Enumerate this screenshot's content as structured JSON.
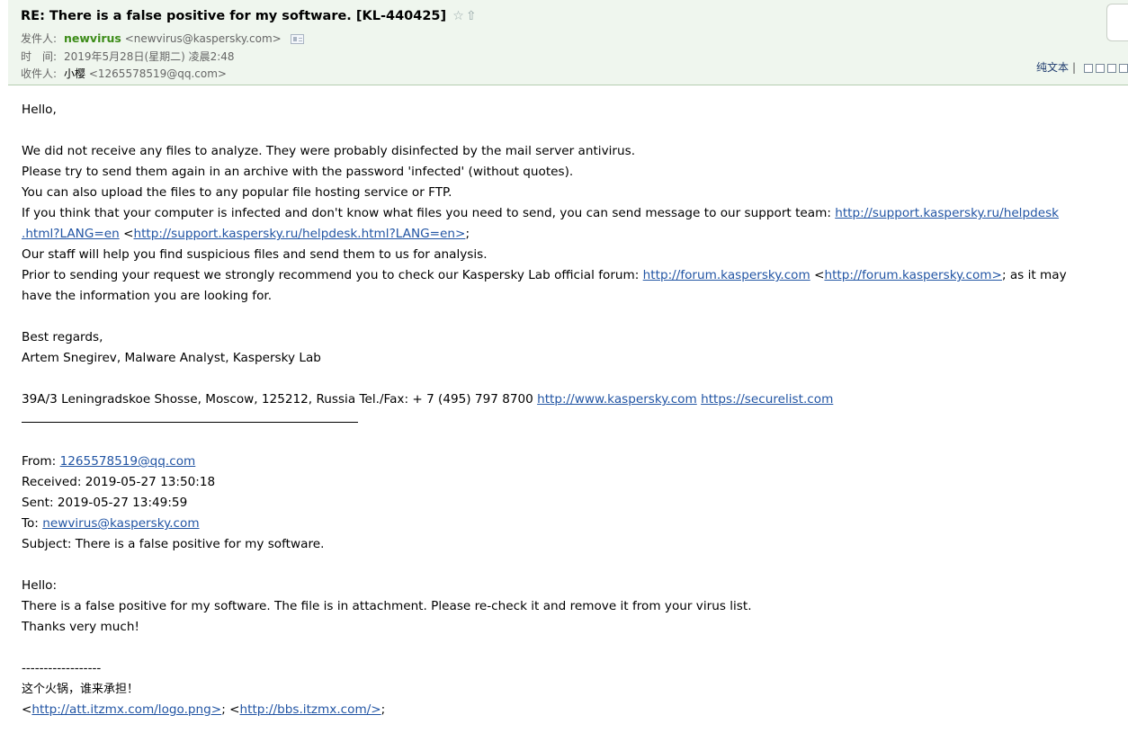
{
  "header": {
    "subject": "RE: There is a false positive for my software. [KL-440425]",
    "star_icon": "star-icon",
    "up_icon": "up-arrow-icon",
    "from_label": "发件人:",
    "from_name": "newvirus",
    "from_email": "<newvirus@kaspersky.com>",
    "time_label": "时　间:",
    "time_value": "2019年5月28日(星期二) 凌晨2:48",
    "to_label": "收件人:",
    "to_name": "小樱",
    "to_email": "<1265578519@qq.com>",
    "plain_text": "纯文本",
    "separator": "|"
  },
  "body": {
    "greeting": "Hello,",
    "p1": "We did not receive any files to analyze. They were probably disinfected by the mail server antivirus.",
    "p2": "Please try to send them again in an archive with the password 'infected' (without quotes).",
    "p3": "You can also upload the files to any popular file hosting service or FTP.",
    "p4_text": "If you think that your computer is infected and don't know what files you need to send, you can send message to our support team: ",
    "p4_link1": "http://support.kaspersky.ru/helpdesk",
    "p4_link1_cont": ".html?LANG=en",
    "p4_lt": " <",
    "p4_link2": "http://support.kaspersky.ru/helpdesk.html?LANG=en>",
    "p4_end": ";",
    "p5": "Our staff will help you find suspicious files and send them to us for analysis.",
    "p6_text": "Prior to sending your request we strongly recommend you to check our Kaspersky Lab official forum: ",
    "p6_link1": "http://forum.kaspersky.com",
    "p6_lt": " <",
    "p6_link2": "http://forum.kaspersky.com>",
    "p6_end": "; as it may",
    "p6_cont": "have the information you are looking for.",
    "regards": "Best regards,",
    "signature": "Artem Snegirev, Malware Analyst, Kaspersky Lab",
    "address": "39A/3 Leningradskoe Shosse, Moscow, 125212, Russia Tel./Fax: + 7 (495) 797 8700 ",
    "site_link1": "http://www.kaspersky.com",
    "site_link2": "https://securelist.com"
  },
  "quoted": {
    "from_label": "From: ",
    "from_value": "1265578519@qq.com",
    "received": "Received: 2019-05-27 13:50:18",
    "sent": "Sent: 2019-05-27 13:49:59",
    "to_label": "To: ",
    "to_value": "newvirus@kaspersky.com",
    "subject": "Subject: There is a false positive for my software.",
    "hello": "Hello:",
    "line1": "There is a false positive for my software. The file is in attachment. Please re-check it and remove it from your virus list.",
    "line2": "Thanks very much!",
    "dashes": "------------------",
    "sig_cn": "这个火锅，谁来承担！",
    "sig_lt1": "<",
    "sig_link1": "http://att.itzmx.com/logo.png>",
    "sig_mid": "; <",
    "sig_link2": "http://bbs.itzmx.com/>",
    "sig_end": ";"
  },
  "colors": {
    "header_bg": "#eff6ee",
    "sender_name": "#3c8c18",
    "link": "#2255a4"
  }
}
